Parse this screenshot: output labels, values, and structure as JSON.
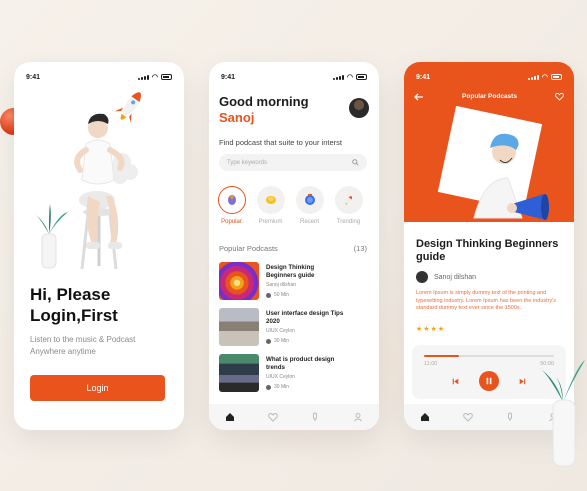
{
  "colors": {
    "accent": "#e9531c",
    "star": "#f2a21a"
  },
  "status_time": "9:41",
  "login_screen": {
    "title_line1": "Hi, Please",
    "title_line2": "Login,First",
    "subtitle": "Listen to the music & Podcast Anywhere anytime",
    "login_button": "Login"
  },
  "home_screen": {
    "greeting": "Good morning",
    "user_name": "Sanoj",
    "prompt": "Find podcast that suite to your interst",
    "search_placeholder": "Type keywords",
    "categories": [
      {
        "label": "Popular",
        "icon": "trophy-icon",
        "active": true
      },
      {
        "label": "Premium",
        "icon": "coins-icon",
        "active": false
      },
      {
        "label": "Recent",
        "icon": "clock-icon",
        "active": false
      },
      {
        "label": "Trending",
        "icon": "rocket-icon",
        "active": false
      }
    ],
    "section_title": "Popular Podcasts",
    "section_count": "(13)",
    "podcasts": [
      {
        "title": "Design Thinking Beginners guide",
        "author": "Sanoj dilshan",
        "duration": "50 Min"
      },
      {
        "title": "User interface design Tips 2020",
        "author": "UIUX Ceylon",
        "duration": "30 Min"
      },
      {
        "title": "What is product design trends",
        "author": "UIUX Ceylon",
        "duration": "30 Min"
      }
    ],
    "tabs": [
      "home-icon",
      "heart-icon",
      "mic-icon",
      "user-icon"
    ]
  },
  "player_screen": {
    "header_title": "Popular Podcasts",
    "title": "Design Thinking Beginners guide",
    "author": "Sanoj dilshan",
    "description": "Lorem Ipsum is simply dummy text of the printing and typesetting industry. Lorem Ipsum has been the industry's standard dummy text ever since the 1500s.",
    "rating": "★★★★",
    "progress": 0.27,
    "time_current": "11:00",
    "time_total": "50:00"
  }
}
